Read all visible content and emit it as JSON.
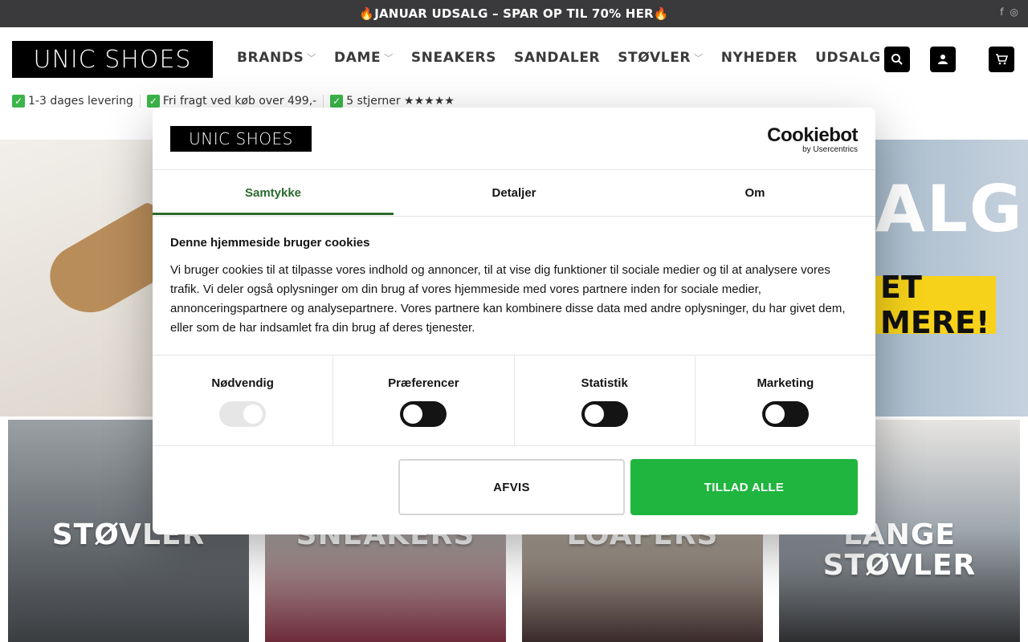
{
  "topbar": {
    "promo": "🔥JANUAR UDSALG – SPAR OP TIL 70% HER🔥",
    "social_icons": [
      "facebook-icon",
      "instagram-icon"
    ]
  },
  "header": {
    "logo": "UNIC SHOES",
    "nav": [
      {
        "label": "BRANDS",
        "dropdown": true
      },
      {
        "label": "DAME",
        "dropdown": true
      },
      {
        "label": "SNEAKERS",
        "dropdown": false
      },
      {
        "label": "SANDALER",
        "dropdown": false
      },
      {
        "label": "STØVLER",
        "dropdown": true
      },
      {
        "label": "NYHEDER",
        "dropdown": false
      },
      {
        "label": "UDSALG",
        "dropdown": true
      }
    ],
    "icons": [
      "search-icon",
      "account-icon",
      "cart-icon"
    ],
    "usps": [
      "1-3 dages levering",
      "Fri fragt ved køb over 499,-",
      "5 stjerner ★★★★★"
    ]
  },
  "hero": {
    "banner_text": "ALG",
    "cta": "ET MERE!"
  },
  "categories": [
    "STØVLER",
    "SNEAKERS",
    "LOAFERS",
    "LANGE STØVLER"
  ],
  "cookie_modal": {
    "logo": "UNIC SHOES",
    "provider_name": "Cookiebot",
    "provider_sub": "by Usercentrics",
    "tabs": [
      "Samtykke",
      "Detaljer",
      "Om"
    ],
    "active_tab": "Samtykke",
    "heading": "Denne hjemmeside bruger cookies",
    "body": "Vi bruger cookies til at tilpasse vores indhold og annoncer, til at vise dig funktioner til sociale medier og til at analysere vores trafik. Vi deler også oplysninger om din brug af vores hjemmeside med vores partnere inden for sociale medier, annonceringspartnere og analysepartnere. Vores partnere kan kombinere disse data med andre oplysninger, du har givet dem, eller som de har indsamlet fra din brug af deres tjenester.",
    "toggles": [
      {
        "label": "Nødvendig",
        "enabled": true,
        "disabled": true
      },
      {
        "label": "Præferencer",
        "enabled": false,
        "disabled": false
      },
      {
        "label": "Statistik",
        "enabled": false,
        "disabled": false
      },
      {
        "label": "Marketing",
        "enabled": false,
        "disabled": false
      }
    ],
    "deny_label": "AFVIS",
    "allow_label": "TILLAD ALLE",
    "accent_color": "#1fb53f"
  }
}
